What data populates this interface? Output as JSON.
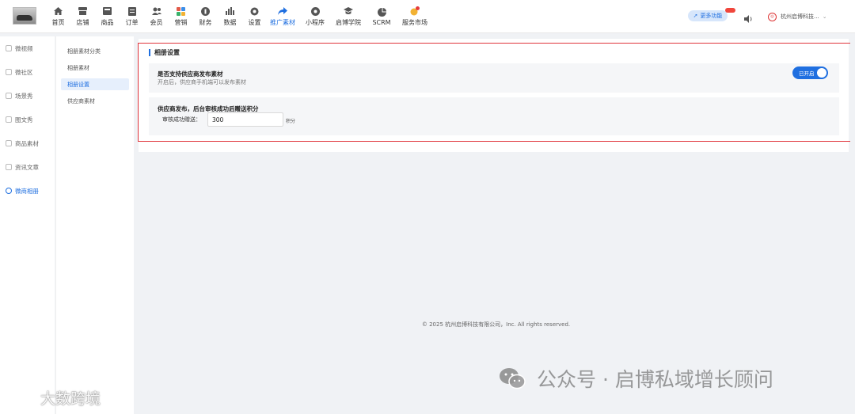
{
  "nav": [
    {
      "label": "首页",
      "icon": "home-icon"
    },
    {
      "label": "店铺",
      "icon": "store-icon"
    },
    {
      "label": "商品",
      "icon": "goods-icon"
    },
    {
      "label": "订单",
      "icon": "order-icon"
    },
    {
      "label": "会员",
      "icon": "member-icon"
    },
    {
      "label": "营销",
      "icon": "marketing-icon"
    },
    {
      "label": "财务",
      "icon": "finance-icon"
    },
    {
      "label": "数据",
      "icon": "data-icon"
    },
    {
      "label": "设置",
      "icon": "settings-icon"
    },
    {
      "label": "推广素材",
      "icon": "share-icon",
      "active": true
    },
    {
      "label": "小程序",
      "icon": "miniapp-icon"
    },
    {
      "label": "启博学院",
      "icon": "academy-icon"
    },
    {
      "label": "SCRM",
      "icon": "scrm-icon"
    },
    {
      "label": "服务市场",
      "icon": "market-icon"
    }
  ],
  "header": {
    "more_label": "更多功能",
    "company": "杭州启博科技...",
    "accent": "#1f6fe0"
  },
  "sidebar": {
    "items": [
      {
        "label": "微视频"
      },
      {
        "label": "微社区"
      },
      {
        "label": "场景秀"
      },
      {
        "label": "图文秀"
      },
      {
        "label": "商品素材"
      },
      {
        "label": "资讯文章"
      },
      {
        "label": "微商相册",
        "active": true
      }
    ]
  },
  "subnav": {
    "items": [
      {
        "label": "相册素材分类"
      },
      {
        "label": "相册素材"
      },
      {
        "label": "相册设置",
        "active": true
      },
      {
        "label": "供应商素材"
      }
    ]
  },
  "settings": {
    "title": "相册设置",
    "supplier_publish": {
      "title": "是否支持供应商发布素材",
      "desc": "开启后，供应商手机端可以发布素材",
      "toggle_label": "已开启",
      "enabled": true
    },
    "reward": {
      "title": "供应商发布，后台审核成功后赠送积分",
      "label": "审核成功赠送：",
      "value": "300",
      "unit": "积分"
    }
  },
  "footer": "© 2025 杭州启博科技有限公司，Inc. All rights reserved.",
  "watermarks": {
    "right": "公众号 · 启博私域增长顾问",
    "left": "大数跨境"
  }
}
